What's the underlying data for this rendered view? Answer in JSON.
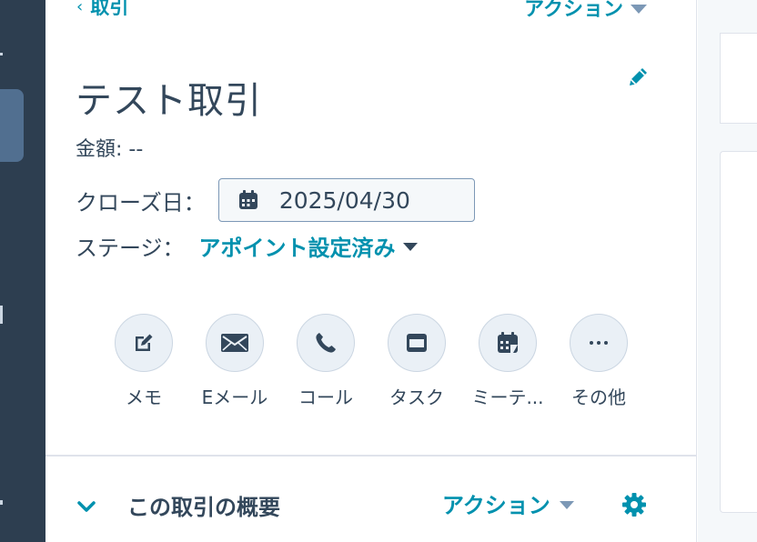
{
  "nav": {
    "back_label": "取引",
    "top_actions_label": "アクション"
  },
  "record": {
    "title": "テスト取引",
    "amount_label": "金額:",
    "amount_value": "--",
    "close_date_label": "クローズ日：",
    "close_date_value": "2025/04/30",
    "stage_label": "ステージ：",
    "stage_value": "アポイント設定済み"
  },
  "quick_actions": [
    {
      "label": "メモ",
      "icon": "note-edit-icon"
    },
    {
      "label": "Eメール",
      "icon": "envelope-icon"
    },
    {
      "label": "コール",
      "icon": "phone-icon"
    },
    {
      "label": "タスク",
      "icon": "task-icon"
    },
    {
      "label": "ミーテ...",
      "icon": "meeting-calendar-icon"
    },
    {
      "label": "その他",
      "icon": "more-icon"
    }
  ],
  "section": {
    "title": "この取引の概要",
    "actions_label": "アクション"
  },
  "colors": {
    "accent": "#0091ae",
    "text": "#33475b",
    "nav_bg": "#2d3e50",
    "button_bg": "#eaf0f6"
  }
}
